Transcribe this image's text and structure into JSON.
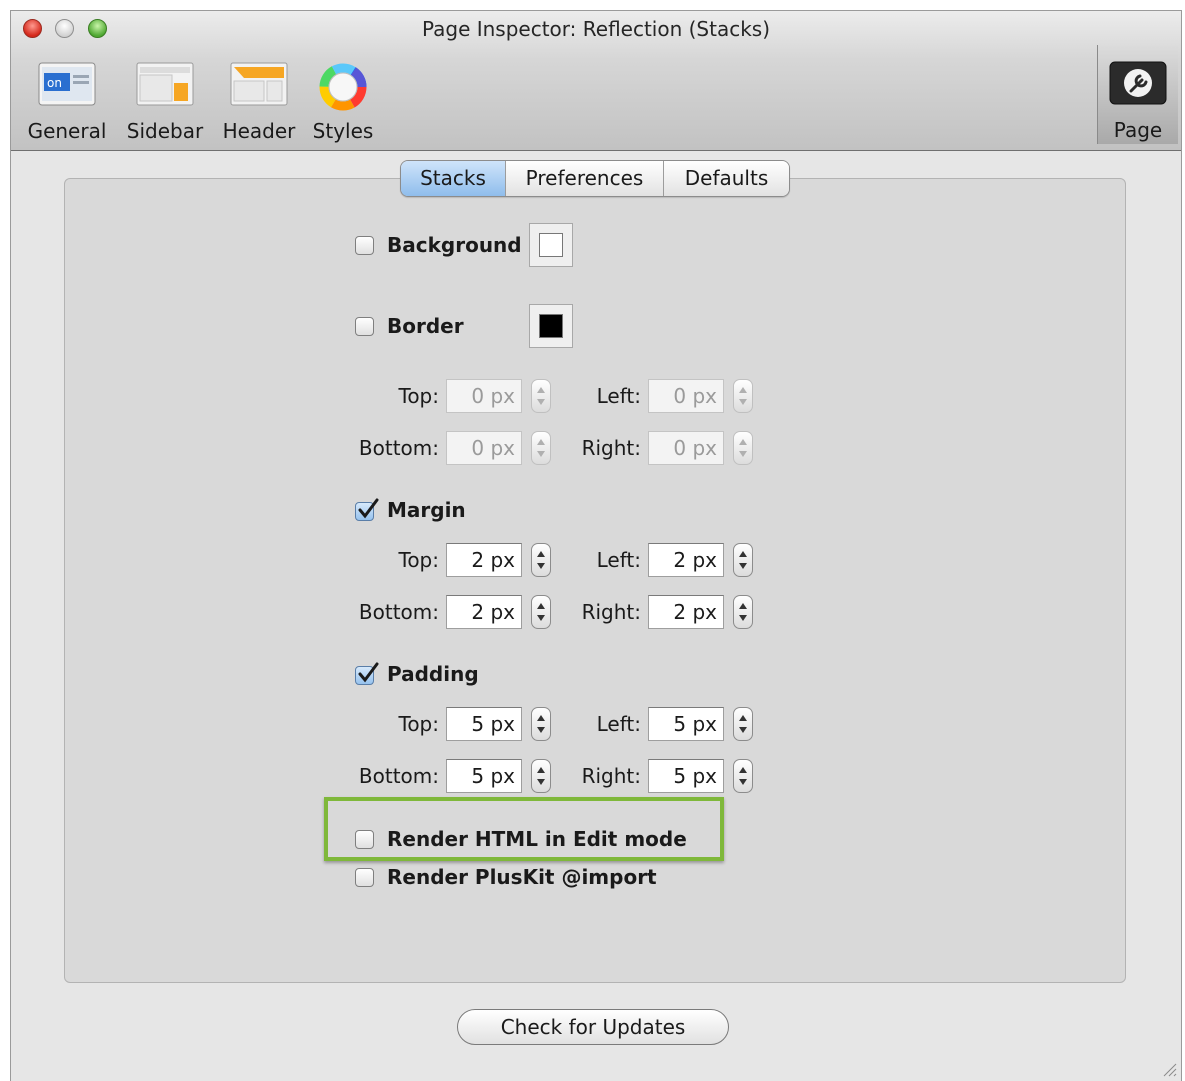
{
  "window": {
    "title": "Page Inspector: Reflection (Stacks)"
  },
  "toolbar": {
    "items": [
      {
        "label": "General",
        "icon": "general-icon"
      },
      {
        "label": "Sidebar",
        "icon": "sidebar-icon"
      },
      {
        "label": "Header",
        "icon": "header-icon"
      },
      {
        "label": "Styles",
        "icon": "styles-color-wheel-icon"
      }
    ],
    "general_icon_text": "on",
    "right_item": {
      "label": "Page",
      "icon": "page-wrench-icon"
    }
  },
  "tabs": [
    {
      "label": "Stacks",
      "selected": true
    },
    {
      "label": "Preferences",
      "selected": false
    },
    {
      "label": "Defaults",
      "selected": false
    }
  ],
  "background": {
    "label": "Background",
    "checked": false,
    "color": "#ffffff"
  },
  "border": {
    "label": "Border",
    "checked": false,
    "color": "#000000",
    "fields": {
      "top_label": "Top:",
      "top": "0 px",
      "left_label": "Left:",
      "left": "0 px",
      "bottom_label": "Bottom:",
      "bottom": "0 px",
      "right_label": "Right:",
      "right": "0 px"
    }
  },
  "margin": {
    "label": "Margin",
    "checked": true,
    "fields": {
      "top_label": "Top:",
      "top": "2 px",
      "left_label": "Left:",
      "left": "2 px",
      "bottom_label": "Bottom:",
      "bottom": "2 px",
      "right_label": "Right:",
      "right": "2 px"
    }
  },
  "padding": {
    "label": "Padding",
    "checked": true,
    "fields": {
      "top_label": "Top:",
      "top": "5 px",
      "left_label": "Left:",
      "left": "5 px",
      "bottom_label": "Bottom:",
      "bottom": "5 px",
      "right_label": "Right:",
      "right": "5 px"
    }
  },
  "options": {
    "render_html_label": "Render HTML in Edit mode",
    "render_pluskit_label": "Render PlusKit @import"
  },
  "check_updates_label": "Check for Updates",
  "colors": {
    "highlight": "#7fb83a",
    "tab_selected": "#8fbdec"
  }
}
